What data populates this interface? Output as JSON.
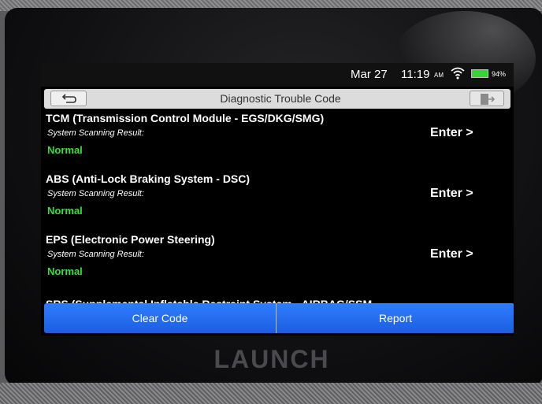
{
  "device": {
    "brand": "LAUNCH"
  },
  "status_bar": {
    "date": "Mar 27",
    "time": "11:19",
    "ampm": "AM",
    "battery": "94%",
    "battery_level": 0.94
  },
  "header": {
    "title": "Diagnostic Trouble Code"
  },
  "systems": [
    {
      "name": "TCM (Transmission Control Module - EGS/DKG/SMG)",
      "result_label": "System Scanning Result:",
      "result": "Normal",
      "action": "Enter >"
    },
    {
      "name": "ABS (Anti-Lock Braking System - DSC)",
      "result_label": "System Scanning Result:",
      "result": "Normal",
      "action": "Enter >"
    },
    {
      "name": "EPS (Electronic Power Steering)",
      "result_label": "System Scanning Result:",
      "result": "Normal",
      "action": "Enter >"
    },
    {
      "name": "SRS (Supplemental Inflatable Restraint System - AIRBAG/SSM"
    }
  ],
  "footer": {
    "clear_code": "Clear Code",
    "report": "Report"
  },
  "colors": {
    "accent_blue": "#2f7cff",
    "normal_green": "#33e03a",
    "battery_green": "#38d23a"
  },
  "icons": {
    "back": "back-arrow-icon",
    "exit": "exit-icon",
    "wifi": "wifi-icon",
    "battery": "battery-icon"
  }
}
